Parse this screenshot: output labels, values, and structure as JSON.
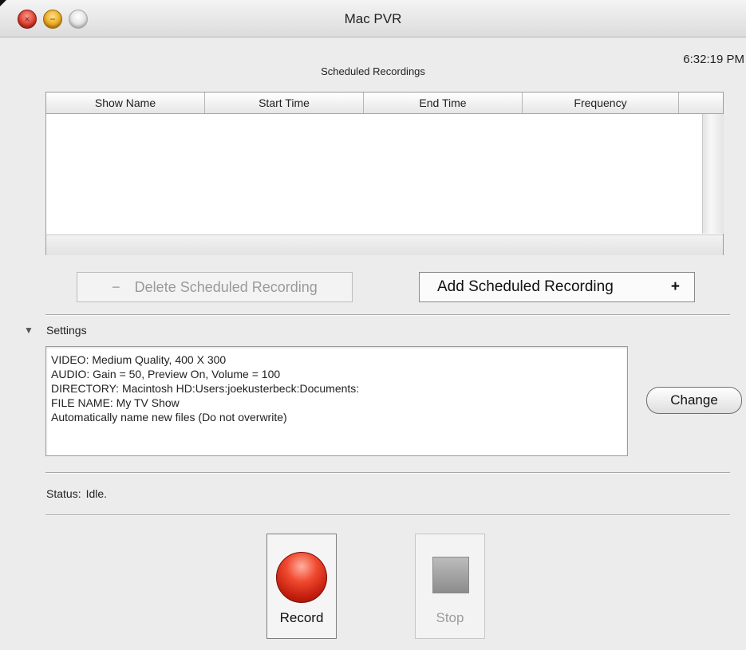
{
  "window": {
    "title": "Mac PVR"
  },
  "clock": "6:32:19 PM",
  "scheduled": {
    "label": "Scheduled Recordings",
    "columns": [
      "Show Name",
      "Start Time",
      "End Time",
      "Frequency",
      ""
    ],
    "rows": []
  },
  "buttons": {
    "delete_label": "Delete Scheduled Recording",
    "delete_symbol": "−",
    "add_label": "Add Scheduled Recording",
    "add_symbol": "+",
    "change_label": "Change",
    "record_label": "Record",
    "stop_label": "Stop"
  },
  "settings": {
    "label": "Settings",
    "disclosure_symbol": "▼",
    "lines": [
      "VIDEO: Medium Quality, 400 X 300",
      "AUDIO: Gain = 50, Preview On, Volume = 100",
      "DIRECTORY:  Macintosh HD:Users:joekusterbeck:Documents:",
      "FILE NAME:  My TV Show",
      "Automatically name new files (Do not overwrite)"
    ]
  },
  "status": {
    "label": "Status:",
    "value": "Idle."
  },
  "icons": {
    "close": "close-icon",
    "minimize": "minimize-icon",
    "zoom": "zoom-icon",
    "record": "record-icon",
    "stop": "stop-icon"
  },
  "colors": {
    "record_red": "#e0321c",
    "window_bg": "#ececec"
  }
}
